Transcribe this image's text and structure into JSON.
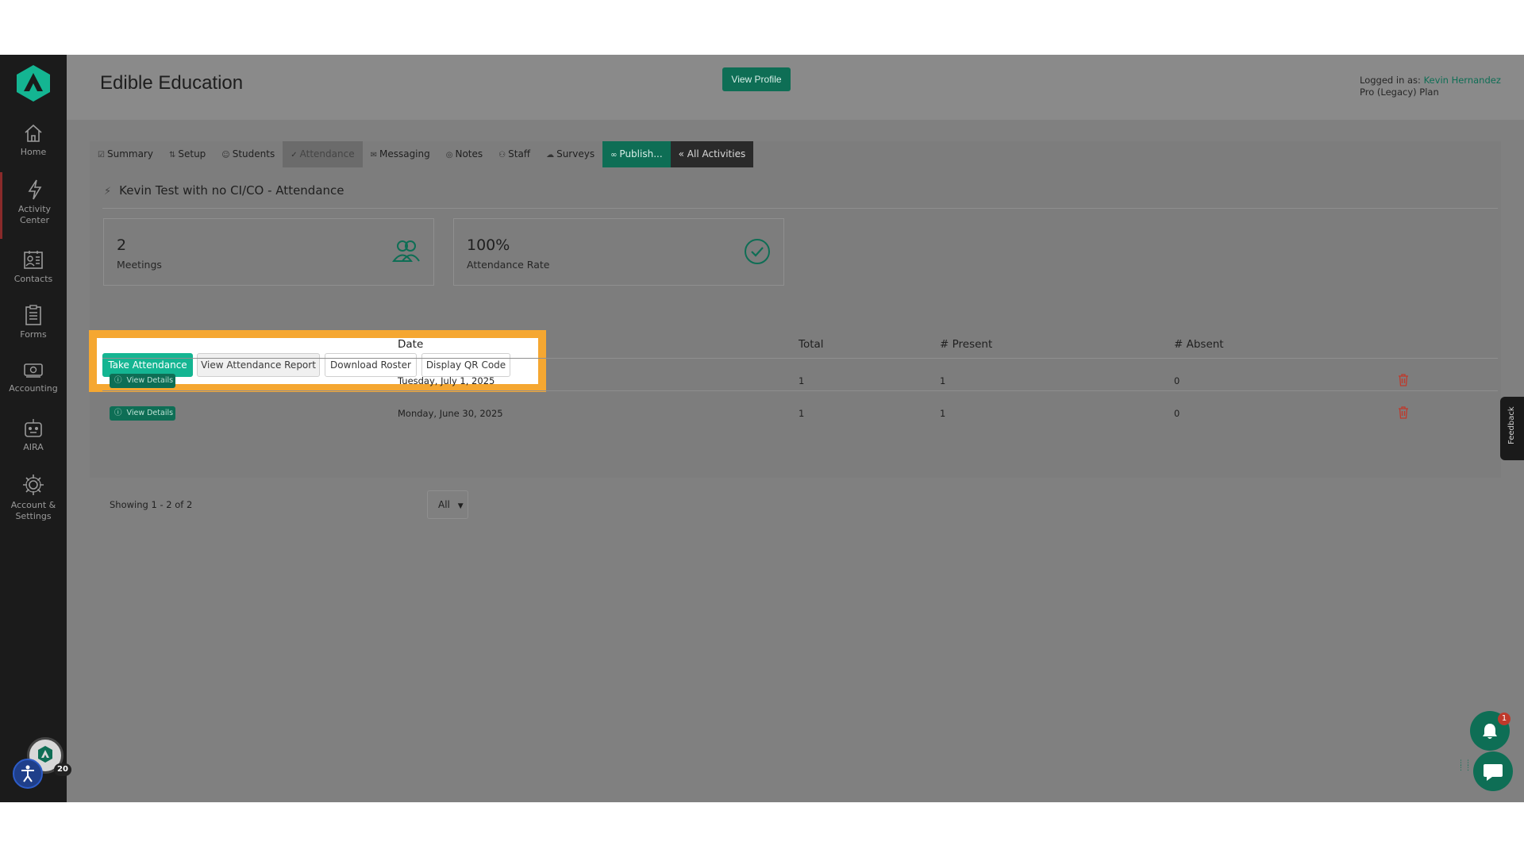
{
  "sidebar": {
    "items": [
      {
        "label": "Home",
        "icon": "home-icon"
      },
      {
        "label": "Activity Center",
        "icon": "bolt-icon"
      },
      {
        "label": "Contacts",
        "icon": "contacts-icon"
      },
      {
        "label": "Forms",
        "icon": "clipboard-icon"
      },
      {
        "label": "Accounting",
        "icon": "money-icon"
      },
      {
        "label": "AIRA",
        "icon": "robot-icon"
      },
      {
        "label": "Account & Settings",
        "icon": "gear-icon"
      }
    ],
    "notification_count": "20"
  },
  "header": {
    "title": "Edible Education",
    "view_profile": "View Profile",
    "logged_in_label": "Logged in as:",
    "user_name": "Kevin Hernandez",
    "plan": "Pro (Legacy) Plan"
  },
  "tabs": [
    {
      "label": "Summary",
      "icon": "☑"
    },
    {
      "label": "Setup",
      "icon": "⇅"
    },
    {
      "label": "Students",
      "icon": "☺"
    },
    {
      "label": "Attendance",
      "icon": "✓"
    },
    {
      "label": "Messaging",
      "icon": "✉"
    },
    {
      "label": "Notes",
      "icon": "◎"
    },
    {
      "label": "Staff",
      "icon": "⚇"
    },
    {
      "label": "Surveys",
      "icon": "☁"
    },
    {
      "label": "Publish...",
      "icon": "🔗"
    },
    {
      "label": "« All Activities",
      "icon": ""
    }
  ],
  "section_title": "Kevin Test with no CI/CO - Attendance",
  "stats": [
    {
      "value": "2",
      "label": "Meetings",
      "icon": "people-icon"
    },
    {
      "value": "100%",
      "label": "Attendance Rate",
      "icon": "check-circle-icon"
    }
  ],
  "actions": {
    "take": "Take Attendance",
    "report": "View Attendance Report",
    "roster": "Download Roster",
    "qr": "Display QR Code"
  },
  "table": {
    "columns": [
      "Date",
      "Total",
      "# Present",
      "# Absent"
    ],
    "details_label": "View Details",
    "rows": [
      {
        "date": "Tuesday, July 1, 2025",
        "total": "1",
        "present": "1",
        "absent": "0"
      },
      {
        "date": "Monday, June 30, 2025",
        "total": "1",
        "present": "1",
        "absent": "0"
      }
    ]
  },
  "pagination": {
    "showing": "Showing 1 - 2 of 2",
    "per_page": "All"
  },
  "feedback": "Feedback",
  "bell_badge": "1",
  "colors": {
    "brand_green": "#0e6e55",
    "accent_teal": "#14b592",
    "highlight_orange": "#f5a731",
    "sidebar_bg": "#1b1b1b",
    "delete_red": "#c0392b"
  }
}
